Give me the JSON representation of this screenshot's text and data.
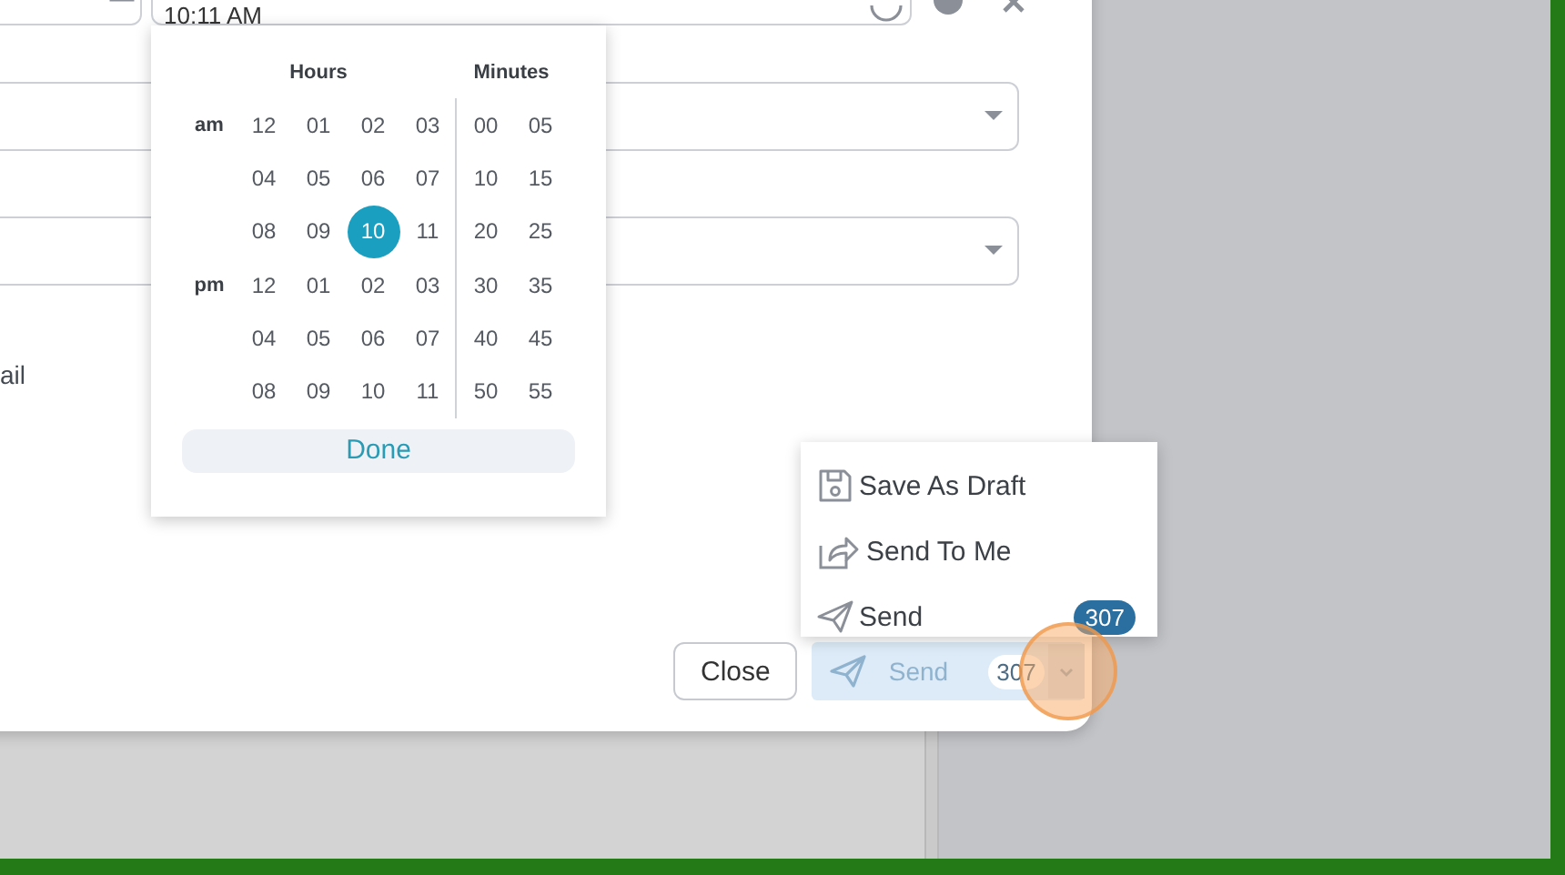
{
  "time_field": {
    "value": "10:11 AM"
  },
  "time_picker": {
    "hours_label": "Hours",
    "minutes_label": "Minutes",
    "rows": [
      {
        "period": "am",
        "hours": [
          {
            "label": "12",
            "selected": false
          },
          {
            "label": "01",
            "selected": false
          },
          {
            "label": "02",
            "selected": false
          },
          {
            "label": "03",
            "selected": false
          }
        ],
        "minutes": [
          "00",
          "05"
        ]
      },
      {
        "hours": [
          {
            "label": "04",
            "selected": false
          },
          {
            "label": "05",
            "selected": false
          },
          {
            "label": "06",
            "selected": false
          },
          {
            "label": "07",
            "selected": false
          }
        ],
        "minutes": [
          "10",
          "15"
        ]
      },
      {
        "hours": [
          {
            "label": "08",
            "selected": false
          },
          {
            "label": "09",
            "selected": false
          },
          {
            "label": "10",
            "selected": true
          },
          {
            "label": "11",
            "selected": false
          }
        ],
        "minutes": [
          "20",
          "25"
        ]
      },
      {
        "period": "pm",
        "hours": [
          {
            "label": "12",
            "selected": false
          },
          {
            "label": "01",
            "selected": false
          },
          {
            "label": "02",
            "selected": false
          },
          {
            "label": "03",
            "selected": false
          }
        ],
        "minutes": [
          "30",
          "35"
        ]
      },
      {
        "hours": [
          {
            "label": "04",
            "selected": false
          },
          {
            "label": "05",
            "selected": false
          },
          {
            "label": "06",
            "selected": false
          },
          {
            "label": "07",
            "selected": false
          }
        ],
        "minutes": [
          "40",
          "45"
        ]
      },
      {
        "hours": [
          {
            "label": "08",
            "selected": false
          },
          {
            "label": "09",
            "selected": false
          },
          {
            "label": "10",
            "selected": false
          },
          {
            "label": "11",
            "selected": false
          }
        ],
        "minutes": [
          "50",
          "55"
        ]
      }
    ],
    "done_button": "Done"
  },
  "form_text": "ail",
  "close_button": "Close",
  "send_button": {
    "label": "Send",
    "count": "307",
    "disabled": true
  },
  "send_menu": [
    {
      "kind": "draft",
      "label": "Save As Draft"
    },
    {
      "kind": "send_to_me",
      "label": "Send To Me"
    },
    {
      "kind": "send",
      "label": "Send",
      "count": "307"
    }
  ]
}
